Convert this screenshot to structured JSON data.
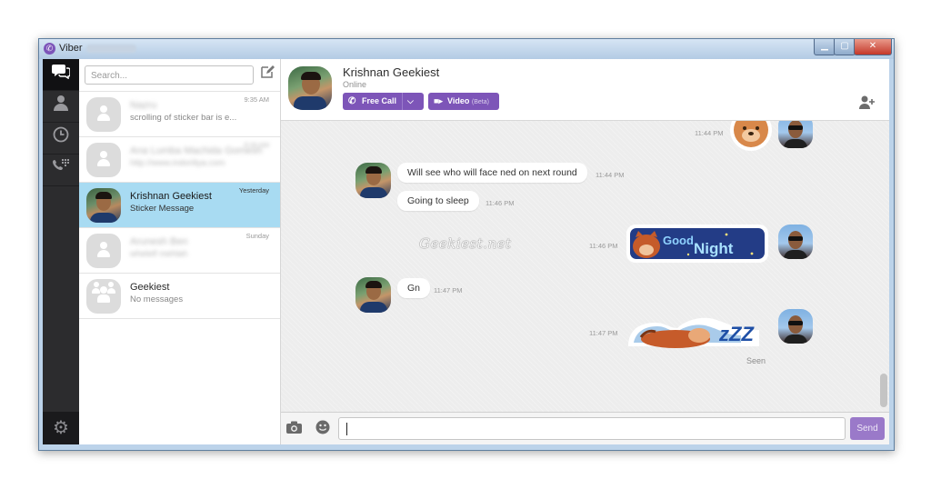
{
  "window": {
    "title": "Viber",
    "app_icon": "viber-icon"
  },
  "rail": {
    "items": [
      "chats-icon",
      "contacts-icon",
      "recents-icon",
      "dialpad-icon"
    ],
    "settings_icon": "gear-icon"
  },
  "sidebar": {
    "search_placeholder": "Search...",
    "chats": [
      {
        "name": "Nazru",
        "preview": "scrolling of sticker bar is e...",
        "time": "9:35 AM"
      },
      {
        "name": "Ana Lumba Machida Gomesh",
        "preview": "http://www.indoriliya.com",
        "time": "8:30 AM"
      },
      {
        "name": "Krishnan Geekiest",
        "preview": "Sticker Message",
        "time": "Yesterday"
      },
      {
        "name": "Arunesh Ben",
        "preview": "whelelf mehlah",
        "time": "Sunday"
      },
      {
        "name": "Geekiest",
        "preview": "No messages",
        "time": ""
      }
    ]
  },
  "conversation": {
    "contact_name": "Krishnan Geekiest",
    "status": "Online",
    "free_call_label": "Free Call",
    "video_label": "Video",
    "video_beta": "(Beta)",
    "messages": [
      {
        "text": "Will see who will face ned on next round",
        "time": "11:44 PM"
      },
      {
        "text": "Going to sleep",
        "time": "11:46 PM"
      },
      {
        "text": "Gn",
        "time": "11:47 PM"
      }
    ],
    "outgoing": [
      {
        "sticker": "bear-face-sticker",
        "time": "11:44 PM"
      },
      {
        "sticker": "good-night-sticker",
        "sticker_text": [
          "Good",
          "Night"
        ],
        "time": "11:46 PM"
      },
      {
        "sticker": "sleeping-zzz-sticker",
        "sticker_text": "zZZ",
        "time": "11:47 PM"
      }
    ],
    "watermark": "Geekiest.net",
    "seen_label": "Seen",
    "send_label": "Send"
  }
}
